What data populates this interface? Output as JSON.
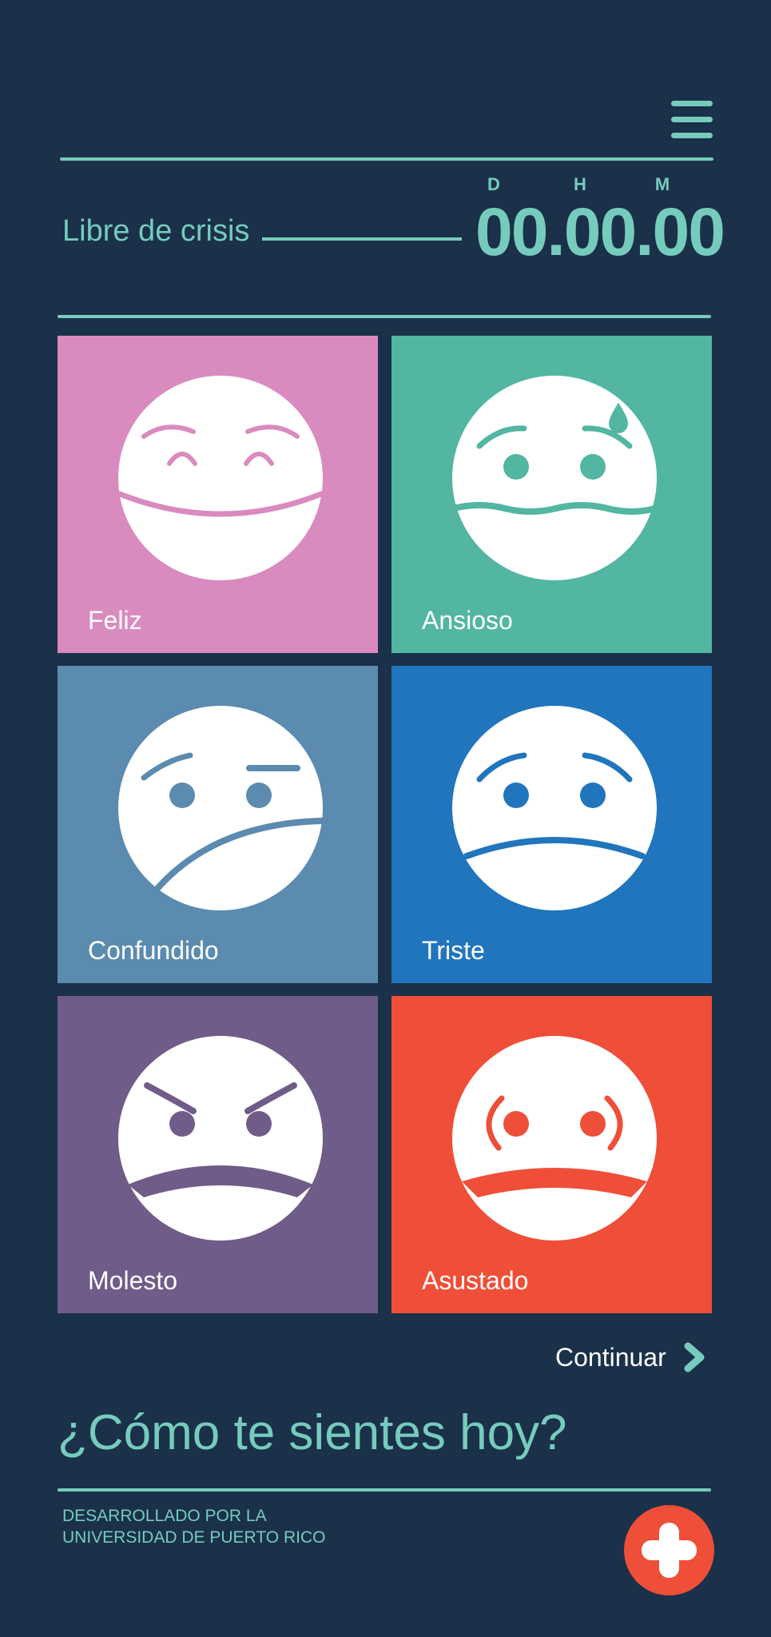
{
  "header": {
    "menu_icon": "hamburger-menu-icon"
  },
  "counter": {
    "label": "Libre de crisis",
    "units": [
      "D",
      "H",
      "M"
    ],
    "value": "00.00.00"
  },
  "moods": [
    {
      "label": "Feliz",
      "icon": "happy-face-icon",
      "color": "#d98bbf"
    },
    {
      "label": "Ansioso",
      "icon": "anxious-face-icon",
      "color": "#52b6a2"
    },
    {
      "label": "Confundido",
      "icon": "confused-face-icon",
      "color": "#5b8baf"
    },
    {
      "label": "Triste",
      "icon": "sad-face-icon",
      "color": "#2075bd"
    },
    {
      "label": "Molesto",
      "icon": "angry-face-icon",
      "color": "#705c88"
    },
    {
      "label": "Asustado",
      "icon": "scared-face-icon",
      "color": "#ef4e38"
    }
  ],
  "continue_label": "Continuar",
  "question": "¿Cómo te sientes hoy?",
  "credits": {
    "line1": "DESARROLLADO POR LA",
    "line2": "UNIVERSIDAD DE PUERTO RICO"
  },
  "sos_icon": "plus-cross-icon",
  "colors": {
    "background": "#1a3149",
    "accent": "#76cbbd",
    "emergency": "#ef4e38"
  }
}
